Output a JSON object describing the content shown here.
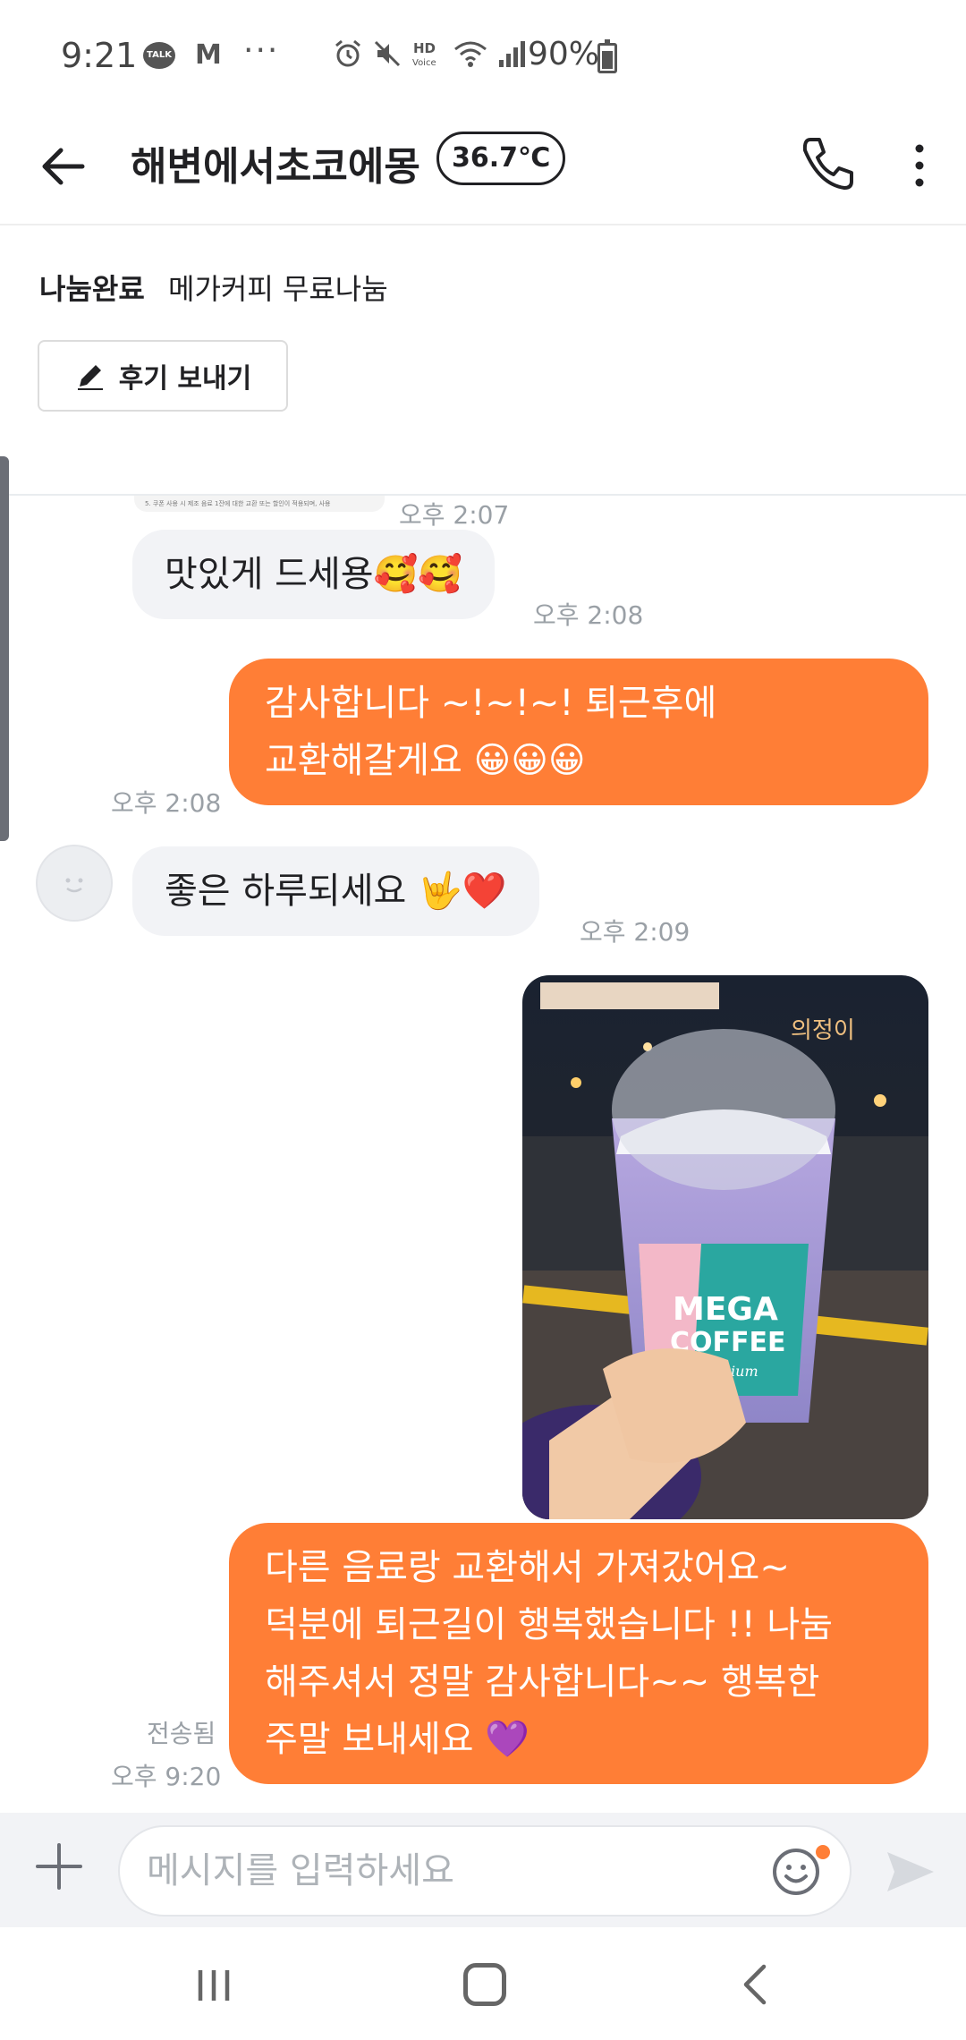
{
  "status_bar": {
    "time": "9:21",
    "talk_badge": "TALK",
    "mail_letter": "M",
    "dots": "···",
    "battery_percent": "90%",
    "icons": [
      "alarm-icon",
      "mute-icon",
      "hd-voice-icon",
      "wifi-icon",
      "signal-icon",
      "battery-charging-icon"
    ]
  },
  "header": {
    "title": "해변에서초코에몽",
    "temperature": "36.7℃"
  },
  "product": {
    "status": "나눔완료",
    "title": "메가커피 무료나눔",
    "review_button": "후기 보내기"
  },
  "messages": {
    "prev_time": "오후 2:07",
    "prev_image_text": "5. 쿠폰 사용 시 제조 음료 1잔에 대한 교환 또는 할인이 적용되며, 사용",
    "m1": {
      "text": "맛있게 드세용🥰🥰",
      "time": "오후 2:08"
    },
    "m2": {
      "line1": "감사합니다 ~!~!~! 퇴근후에",
      "line2": "교환해갈게요 😀😀😀",
      "time": "오후 2:08"
    },
    "m3": {
      "text": "좋은 하루되세요 🤟❤️",
      "time": "오후 2:09"
    },
    "photo": {
      "cup_text_1": "MEGA",
      "cup_text_2": "COFFEE",
      "cup_text_3": "Premium",
      "sign_text": "의정이"
    },
    "m4": {
      "line1": "다른 음료랑 교환해서 가져갔어요~",
      "line2": "덕분에 퇴근길이 행복했습니다 !! 나눔",
      "line3": "해주셔서 정말 감사합니다~~ 행복한",
      "line4": "주말 보내세요 💜",
      "sent": "전송됨",
      "time": "오후 9:20"
    }
  },
  "input": {
    "placeholder": "메시지를 입력하세요"
  },
  "colors": {
    "accent": "#ff7e36",
    "incoming_bubble": "#f2f3f6",
    "timestamp": "#9aa0a6"
  }
}
